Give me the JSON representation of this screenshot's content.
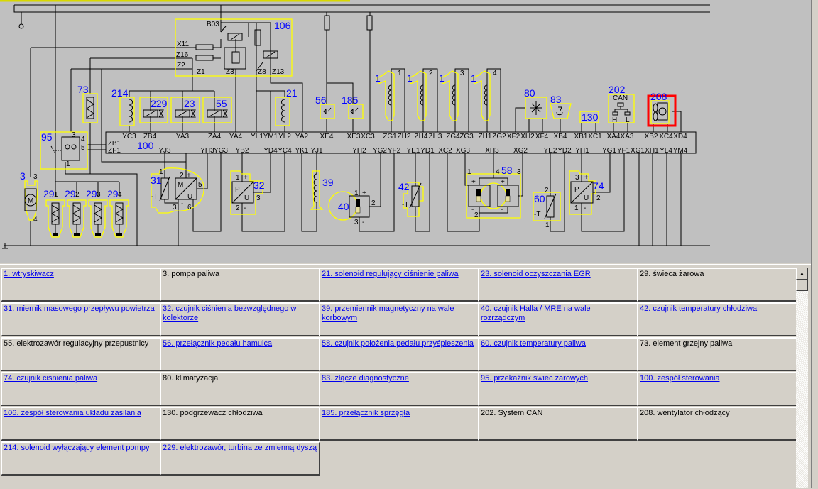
{
  "diagram": {
    "highlight_color": "#ff0000",
    "component_color": "#0000ff",
    "outline_color": "#ffff00",
    "components": [
      "106",
      "73",
      "214",
      "229",
      "23",
      "55",
      "21",
      "56",
      "185",
      "1",
      "1",
      "1",
      "1",
      "80",
      "83",
      "130",
      "202",
      "208",
      "95",
      "100",
      "3",
      "29",
      "29",
      "29",
      "29",
      "31",
      "32",
      "39",
      "40",
      "42",
      "58",
      "60",
      "74"
    ],
    "pins_row1": [
      "YC3",
      "ZB4",
      "YA3",
      "ZA4",
      "YA4",
      "YL1",
      "YM1",
      "YL2",
      "YA2",
      "XE4",
      "XE3",
      "XC3",
      "ZG1",
      "ZH2",
      "ZH4",
      "ZH3",
      "ZG4",
      "ZG3",
      "ZH1",
      "ZG2",
      "XF2",
      "XH2",
      "XF4",
      "XB4",
      "XB1",
      "XC1",
      "XA4",
      "XA3",
      "XB2",
      "XC4",
      "XD4"
    ],
    "pins_row2": [
      "ZB1",
      "ZF1",
      "YJ3",
      "YH3",
      "YG3",
      "YB2",
      "YD4",
      "YC4",
      "YK1",
      "YJ1",
      "YH2",
      "YG2",
      "YF2",
      "YE1",
      "YD1",
      "XC2",
      "XG3",
      "XH3",
      "XG2",
      "YE2",
      "YD2",
      "YH1",
      "YG1",
      "YF1",
      "XG1",
      "XH1",
      "YL4",
      "YM4"
    ],
    "small_labels": [
      "B03",
      "X11",
      "Z16",
      "Z2",
      "Z1",
      "Z3",
      "Z8",
      "Z13",
      "1",
      "2",
      "3",
      "4",
      "CAN",
      "H",
      "L",
      "3",
      "4",
      "5",
      "1",
      "3",
      "4",
      "1",
      "2",
      "3",
      "4",
      "1",
      "2",
      "+",
      "5",
      "3",
      "6",
      "-",
      "-T",
      "M",
      "U",
      "1",
      "+",
      "2",
      "-",
      "3",
      "P",
      "U",
      "1",
      "+",
      "2",
      "3",
      "-",
      "-T",
      "1",
      "4",
      "3",
      "2",
      "+",
      "+",
      "-",
      "-",
      "2",
      "1",
      "-T",
      "3",
      "+",
      "P",
      "U",
      "1",
      "-",
      "2",
      "+"
    ],
    "highlighted_component": "208"
  },
  "legend": {
    "items": [
      {
        "text": "1. wtryskiwacz",
        "link": true
      },
      {
        "text": "3. pompa paliwa",
        "link": false
      },
      {
        "text": "21. solenoid regulujący ciśnienie paliwa",
        "link": true
      },
      {
        "text": "23. solenoid oczyszczania EGR",
        "link": true
      },
      {
        "text": "29. świeca żarowa",
        "link": false
      },
      {
        "text": "31. miernik masowego przepływu powietrza",
        "link": true
      },
      {
        "text": "32. czujnik ciśnienia bezwzględnego w kolektorze",
        "link": true
      },
      {
        "text": "39. przemiennik magnetyczny na wale korbowym",
        "link": true
      },
      {
        "text": "40. czujnik Halla / MRE na wale rozrządczym",
        "link": true
      },
      {
        "text": "42. czujnik temperatury chłodziwa",
        "link": true
      },
      {
        "text": "55. elektrozawór regulacyjny przepustnicy",
        "link": false
      },
      {
        "text": "56. przełącznik pedału hamulca",
        "link": true
      },
      {
        "text": "58. czujnik położenia pedału przyśpieszenia",
        "link": true
      },
      {
        "text": "60. czujnik temperatury paliwa",
        "link": true
      },
      {
        "text": "73. element grzejny paliwa",
        "link": false
      },
      {
        "text": "74. czujnik ciśnienia paliwa",
        "link": true
      },
      {
        "text": "80. klimatyzacja",
        "link": false
      },
      {
        "text": "83. złącze diagnostyczne",
        "link": true
      },
      {
        "text": "95. przekaźnik świec żarowych",
        "link": true
      },
      {
        "text": "100. zespół sterowania",
        "link": true
      },
      {
        "text": "106. zespół sterowania układu zasilania",
        "link": true
      },
      {
        "text": "130. podgrzewacz chłodziwa",
        "link": false
      },
      {
        "text": "185. przełącznik sprzęgła",
        "link": true
      },
      {
        "text": "202. System CAN",
        "link": false
      },
      {
        "text": "208. wentylator chłodzący",
        "link": false
      },
      {
        "text": "214. solenoid wyłączający element pompy",
        "link": true
      },
      {
        "text": "229. elektrozawór, turbina ze zmienną dyszą",
        "link": true
      }
    ]
  },
  "scrollbar": {
    "up_arrow": "▲"
  }
}
